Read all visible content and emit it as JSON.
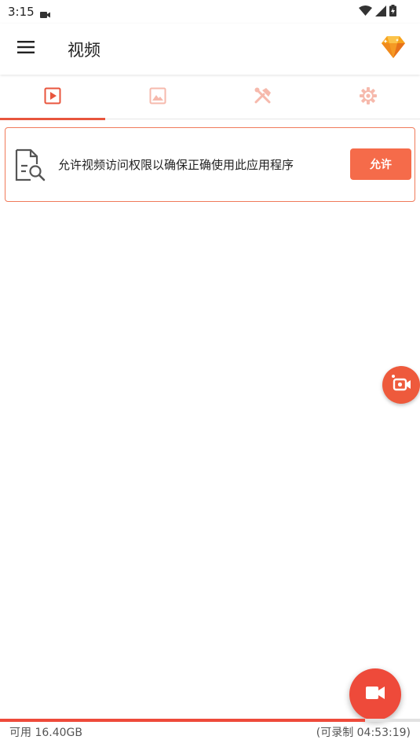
{
  "status_bar": {
    "time": "3:15"
  },
  "app_bar": {
    "title": "视频"
  },
  "tabs": [
    {
      "name": "videos",
      "icon": "play-square-icon",
      "active": true
    },
    {
      "name": "images",
      "icon": "image-icon",
      "active": false
    },
    {
      "name": "tools",
      "icon": "tools-icon",
      "active": false
    },
    {
      "name": "settings",
      "icon": "gear-icon",
      "active": false
    }
  ],
  "permission_card": {
    "message": "允许视频访问权限以确保正确使用此应用程序",
    "allow_label": "允许"
  },
  "footer": {
    "storage_available": "可用 16.40GB",
    "remaining_time": "(可录制 04:53:19)",
    "storage_used_fraction": 0.87
  },
  "colors": {
    "accent": "#ee4a3a",
    "button": "#f56b4a",
    "card_border": "#f07a5a"
  }
}
